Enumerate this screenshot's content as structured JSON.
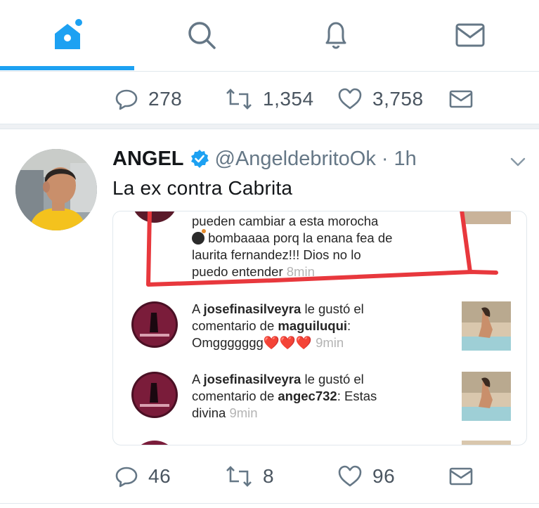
{
  "tabs": [
    {
      "name": "home",
      "icon": "home-icon",
      "active": true
    },
    {
      "name": "search",
      "icon": "search-icon",
      "active": false
    },
    {
      "name": "notifications",
      "icon": "bell-icon",
      "active": false
    },
    {
      "name": "messages",
      "icon": "mail-icon",
      "active": false
    }
  ],
  "colors": {
    "accent": "#1da1f2",
    "icon": "#657786",
    "highlight": "#e8383d"
  },
  "prev_tweet_actions": {
    "replies": "278",
    "retweets": "1,354",
    "likes": "3,758"
  },
  "tweet": {
    "name": "ANGEL",
    "handle": "@AngeldebritoOk",
    "separator": "·",
    "time": "1h",
    "text": "La ex contra Cabrita",
    "actions": {
      "replies": "46",
      "retweets": "8",
      "likes": "96"
    }
  },
  "instagram": {
    "highlighted_comment": {
      "line1": "pueden cambiar a esta morocha",
      "line2": " bombaaaa porq la enana fea de",
      "line3": "laurita fernandez!!! Dios no lo",
      "line4": "puedo entender",
      "time": "8min"
    },
    "activity": [
      {
        "prefix": "A ",
        "user": "josefinasilveyra",
        "mid": " le gustó el",
        "line2_pre": "comentario de ",
        "commenter": "maguiluqui",
        "line2_post": ":",
        "line3": "Omggggggg",
        "emoji": "❤️❤️❤️",
        "time": "9min"
      },
      {
        "prefix": "A ",
        "user": "josefinasilveyra",
        "mid": " le gustó el",
        "line2_pre": "comentario de ",
        "commenter": "angec732",
        "line2_post": ": Estas",
        "line3": "divina",
        "time": "9min"
      }
    ]
  }
}
